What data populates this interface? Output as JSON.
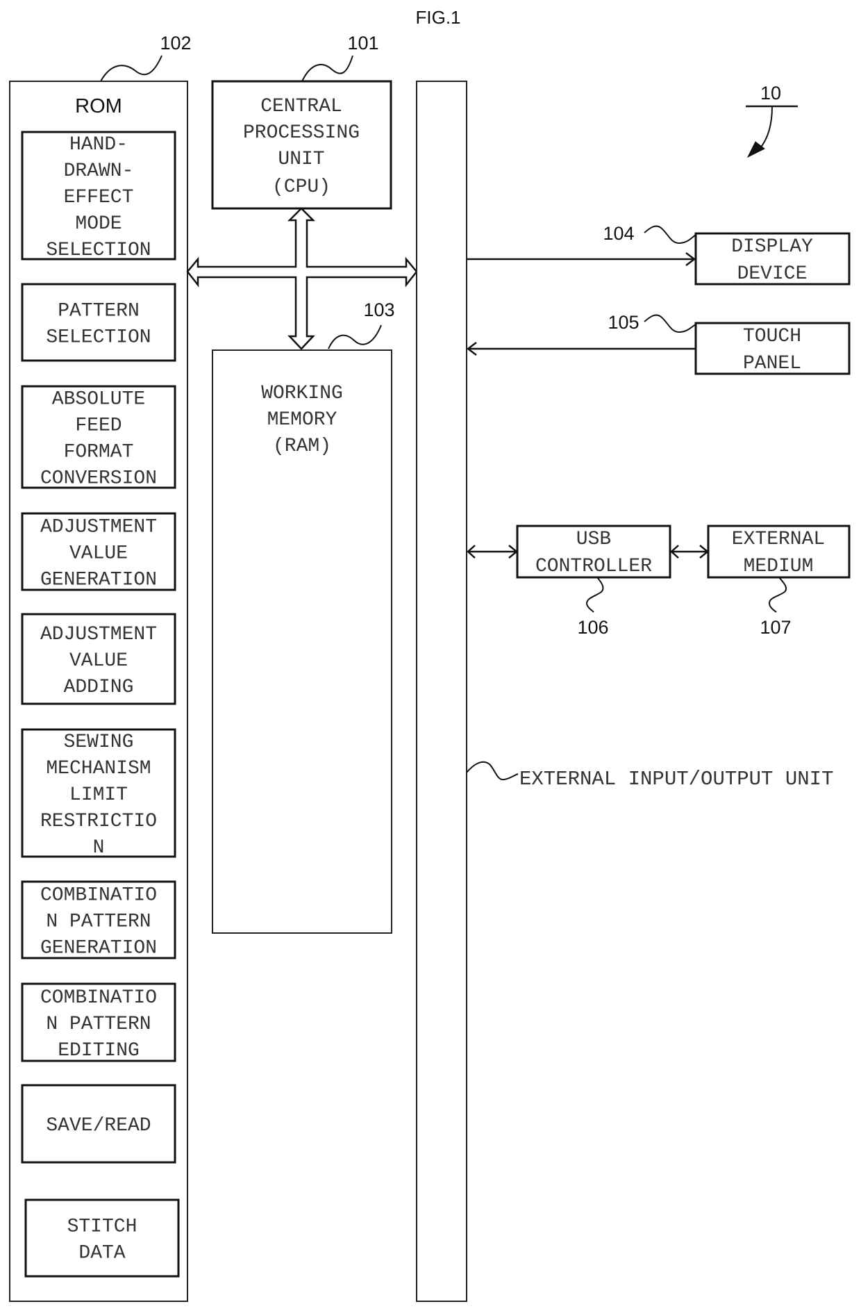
{
  "figure": {
    "title": "FIG.1",
    "system_ref": "10"
  },
  "rom": {
    "ref": "102",
    "title": "ROM",
    "modules": [
      {
        "lines": [
          "HAND-",
          "DRAWN-",
          "EFFECT",
          "MODE",
          "SELECTION"
        ]
      },
      {
        "lines": [
          "PATTERN",
          "SELECTION"
        ]
      },
      {
        "lines": [
          "ABSOLUTE",
          "FEED",
          "FORMAT",
          "CONVERSION"
        ]
      },
      {
        "lines": [
          "ADJUSTMENT",
          "VALUE",
          "GENERATION"
        ]
      },
      {
        "lines": [
          "ADJUSTMENT",
          "VALUE",
          "ADDING"
        ]
      },
      {
        "lines": [
          "SEWING",
          "MECHANISM",
          "LIMIT",
          "RESTRICTIO",
          "N"
        ]
      },
      {
        "lines": [
          "COMBINATIO",
          "N PATTERN",
          "GENERATION"
        ]
      },
      {
        "lines": [
          "COMBINATIO",
          "N PATTERN",
          "EDITING"
        ]
      },
      {
        "lines": [
          "SAVE/READ"
        ]
      },
      {
        "lines": [
          "STITCH",
          "DATA"
        ]
      }
    ]
  },
  "cpu": {
    "ref": "101",
    "lines": [
      "CENTRAL",
      "PROCESSING",
      "UNIT",
      "(CPU)"
    ]
  },
  "ram": {
    "ref": "103",
    "lines": [
      "WORKING",
      "MEMORY",
      "(RAM)"
    ]
  },
  "io_unit": {
    "label": "EXTERNAL INPUT/OUTPUT UNIT"
  },
  "display": {
    "ref": "104",
    "lines": [
      "DISPLAY",
      "DEVICE"
    ]
  },
  "touch": {
    "ref": "105",
    "lines": [
      "TOUCH",
      "PANEL"
    ]
  },
  "usb": {
    "ref": "106",
    "lines": [
      "USB",
      "CONTROLLER"
    ]
  },
  "medium": {
    "ref": "107",
    "lines": [
      "EXTERNAL",
      "MEDIUM"
    ]
  }
}
